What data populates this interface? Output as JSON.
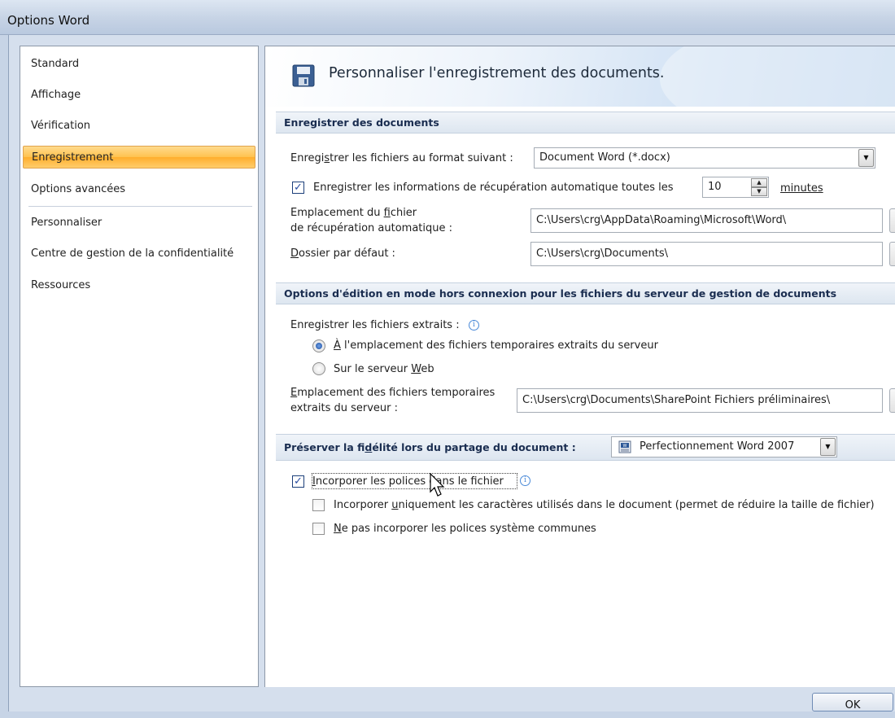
{
  "window": {
    "title": "Options Word"
  },
  "nav": {
    "items": [
      {
        "label": "Standard"
      },
      {
        "label": "Affichage"
      },
      {
        "label": "Vérification"
      },
      {
        "label": "Enregistrement"
      },
      {
        "label": "Options avancées"
      },
      {
        "label": "Personnaliser"
      },
      {
        "label": "Centre de gestion de la confidentialité"
      },
      {
        "label": "Ressources"
      }
    ],
    "active": "Enregistrement"
  },
  "page": {
    "title": "Personnaliser l'enregistrement des documents."
  },
  "sections": {
    "save": {
      "heading": "Enregistrer des documents",
      "format_label_pre": "Enregi",
      "format_label_u": "s",
      "format_label_post": "trer les fichiers au format suivant :",
      "format_value": "Document Word (*.docx)",
      "autorecover_pre": "Enregistrer les informations de récupération automatique toutes les",
      "autorecover_checked": true,
      "autorecover_minutes": "10",
      "minutes_label": "minutes",
      "autorecover_location_line1_pre": "Emplacement du ",
      "autorecover_location_line1_u": "f",
      "autorecover_location_line1_post": "ichier",
      "autorecover_location_line2": "de récupération automatique :",
      "autorecover_location_value": "C:\\Users\\crg\\AppData\\Roaming\\Microsoft\\Word\\",
      "default_folder_u": "D",
      "default_folder_post": "ossier par défaut :",
      "default_folder_value": "C:\\Users\\crg\\Documents\\"
    },
    "offline": {
      "heading": "Options d'édition en mode hors connexion pour les fichiers du serveur de gestion de documents",
      "checked_out_label": "Enregistrer les fichiers extraits :",
      "radio1_u": "À",
      "radio1_post": " l'emplacement des fichiers temporaires extraits du serveur",
      "radio1_selected": true,
      "radio2_pre": "Sur le serveur ",
      "radio2_u": "W",
      "radio2_post": "eb",
      "temp_location_line1_u": "E",
      "temp_location_line1_post": "mplacement des fichiers temporaires",
      "temp_location_line2": "extraits du serveur :",
      "temp_location_value": "C:\\Users\\crg\\Documents\\SharePoint Fichiers préliminaires\\"
    },
    "fidelity": {
      "heading_pre": "Préserver la fi",
      "heading_u": "d",
      "heading_post": "élité lors du partage du document :",
      "document_value": "Perfectionnement Word 2007",
      "embed_fonts_pre": "",
      "embed_fonts_u": "I",
      "embed_fonts_post": "ncorporer les polices dans le fichier",
      "embed_fonts_checked": true,
      "embed_chars_pre": "Incorporer ",
      "embed_chars_u": "u",
      "embed_chars_post": "niquement les caractères utilisés dans le document (permet de réduire la taille de fichier)",
      "embed_chars_checked": false,
      "no_common_u": "N",
      "no_common_post": "e pas incorporer les polices système communes",
      "no_common_checked": false
    }
  },
  "buttons": {
    "ok": "OK"
  },
  "icons": {
    "info": "info-icon",
    "save": "save-icon",
    "dropdown": "chevron-down-icon"
  }
}
